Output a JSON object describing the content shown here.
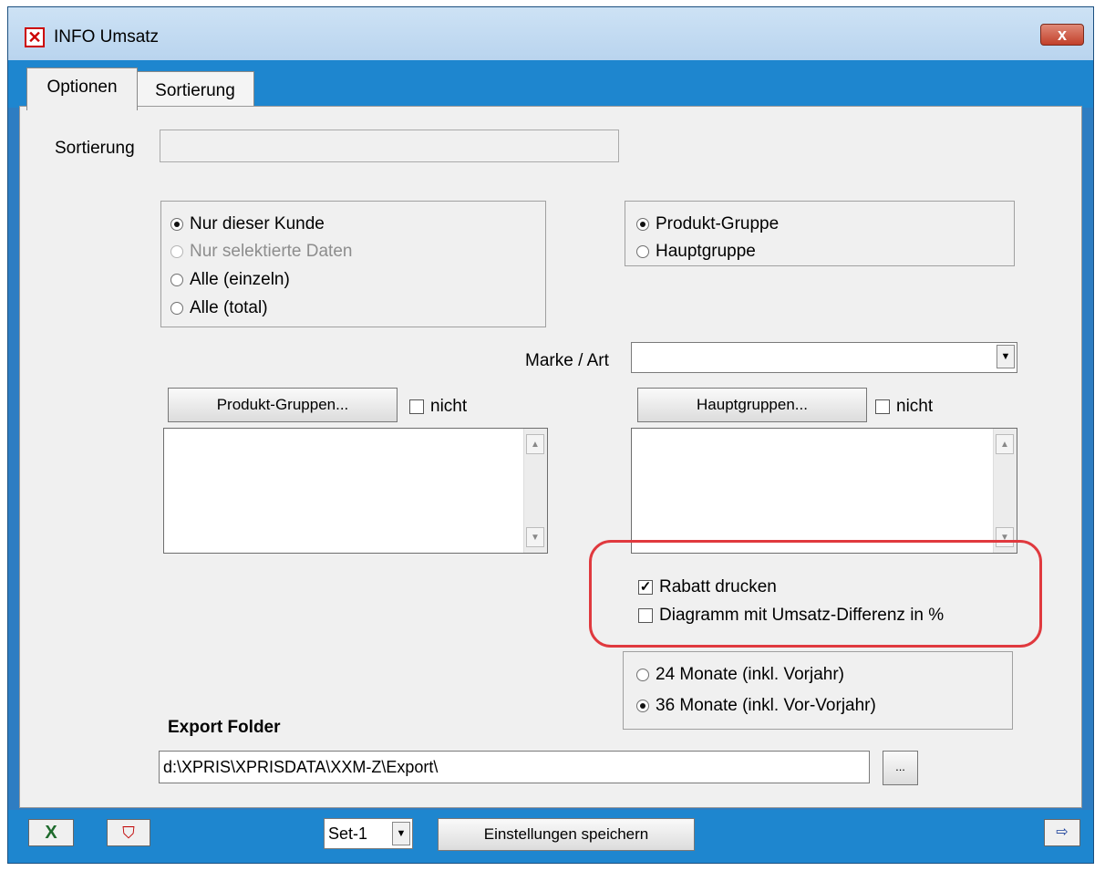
{
  "window": {
    "title": "INFO Umsatz",
    "close_label": "x"
  },
  "tabs": [
    {
      "label": "Optionen"
    },
    {
      "label": "Sortierung"
    }
  ],
  "sortierung": {
    "label": "Sortierung",
    "value": ""
  },
  "customer_scope": {
    "options": [
      {
        "label": "Nur dieser Kunde",
        "selected": true,
        "disabled": false
      },
      {
        "label": "Nur selektierte Daten",
        "selected": false,
        "disabled": true
      },
      {
        "label": "Alle (einzeln)",
        "selected": false,
        "disabled": false
      },
      {
        "label": "Alle (total)",
        "selected": false,
        "disabled": false
      }
    ]
  },
  "grouping": {
    "options": [
      {
        "label": "Produkt-Gruppe",
        "selected": true
      },
      {
        "label": "Hauptgruppe",
        "selected": false
      }
    ]
  },
  "marke": {
    "label": "Marke / Art",
    "value": ""
  },
  "produkt_gruppen": {
    "button_label": "Produkt-Gruppen...",
    "nicht_label": "nicht"
  },
  "hauptgruppen": {
    "button_label": "Hauptgruppen...",
    "nicht_label": "nicht"
  },
  "options": {
    "rabatt_label": "Rabatt drucken",
    "diagramm_label": "Diagramm mit Umsatz-Differenz in %"
  },
  "period": {
    "options": [
      {
        "label": "24 Monate (inkl. Vorjahr)",
        "selected": false
      },
      {
        "label": "36 Monate (inkl. Vor-Vorjahr)",
        "selected": true
      }
    ]
  },
  "export": {
    "label": "Export Folder",
    "path": "d:\\XPRIS\\XPRISDATA\\XXM-Z\\Export\\",
    "browse_label": "..."
  },
  "bottom": {
    "set_value": "Set-1",
    "save_label": "Einstellungen speichern"
  },
  "colors": {
    "highlight": "#e0393e",
    "frame": "#1e86cf"
  }
}
